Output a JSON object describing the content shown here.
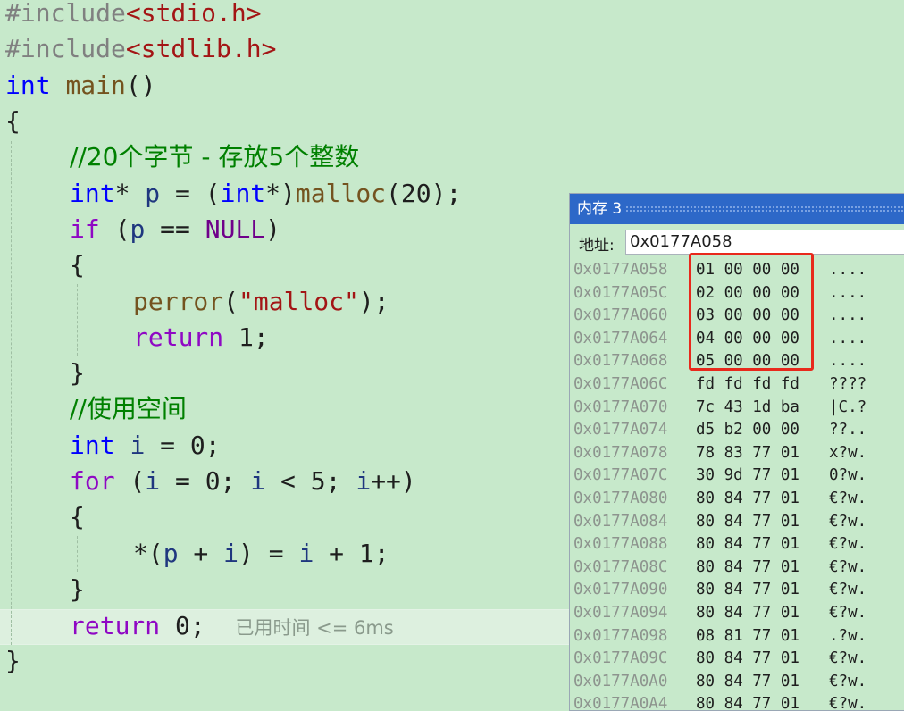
{
  "editor": {
    "include1": {
      "directive": "#include",
      "header": "<stdio.h>"
    },
    "include2": {
      "directive": "#include",
      "header": "<stdlib.h>"
    },
    "main_sig": {
      "type": "int",
      "name": "main",
      "parens": "()"
    },
    "open_brace": "{",
    "comment_alloc": "//20个字节 - 存放5个整数",
    "malloc_line": {
      "t1": "int",
      "p1": "* ",
      "var": "p",
      "p2": " = (",
      "t2": "int",
      "p3": "*)",
      "fn": "malloc",
      "p4": "(20);"
    },
    "if_line": {
      "kw": "if",
      "p1": " (",
      "var": "p",
      "p2": " == ",
      "mac": "NULL",
      "p3": ")"
    },
    "inner_open": "{",
    "perror_line": {
      "fn": "perror",
      "p1": "(",
      "str": "\"malloc\"",
      "p2": ");"
    },
    "return1_line": {
      "kw": "return",
      "rest": " 1;"
    },
    "inner_close": "}",
    "comment_use": "//使用空间",
    "int_i_line": {
      "kw": "int",
      "sp": " ",
      "var": "i",
      "rest": " = 0;"
    },
    "for_line": {
      "kw": "for",
      "p1": " (",
      "v1": "i",
      "p2": " = 0; ",
      "v2": "i",
      "p3": " < 5; ",
      "v3": "i",
      "p4": "++)"
    },
    "for_open": "{",
    "assign_line": {
      "p1": "*(",
      "v1": "p",
      "p2": " + ",
      "v2": "i",
      "p3": ") = ",
      "v3": "i",
      "p4": " + 1;"
    },
    "for_close": "}",
    "return0_line": {
      "kw": "return",
      "rest": " 0;",
      "hint": "已用时间 <= 6ms"
    },
    "close_brace": "}"
  },
  "memory_window": {
    "title": "内存 3",
    "address_label": "地址:",
    "address_value": "0x0177A058",
    "rows": [
      {
        "addr": "0x0177A058",
        "bytes": "01 00 00 00",
        "ascii": "...."
      },
      {
        "addr": "0x0177A05C",
        "bytes": "02 00 00 00",
        "ascii": "...."
      },
      {
        "addr": "0x0177A060",
        "bytes": "03 00 00 00",
        "ascii": "...."
      },
      {
        "addr": "0x0177A064",
        "bytes": "04 00 00 00",
        "ascii": "...."
      },
      {
        "addr": "0x0177A068",
        "bytes": "05 00 00 00",
        "ascii": "...."
      },
      {
        "addr": "0x0177A06C",
        "bytes": "fd fd fd fd",
        "ascii": "????"
      },
      {
        "addr": "0x0177A070",
        "bytes": "7c 43 1d ba",
        "ascii": "|C.?"
      },
      {
        "addr": "0x0177A074",
        "bytes": "d5 b2 00 00",
        "ascii": "??.."
      },
      {
        "addr": "0x0177A078",
        "bytes": "78 83 77 01",
        "ascii": "x?w."
      },
      {
        "addr": "0x0177A07C",
        "bytes": "30 9d 77 01",
        "ascii": "0?w."
      },
      {
        "addr": "0x0177A080",
        "bytes": "80 84 77 01",
        "ascii": "€?w."
      },
      {
        "addr": "0x0177A084",
        "bytes": "80 84 77 01",
        "ascii": "€?w."
      },
      {
        "addr": "0x0177A088",
        "bytes": "80 84 77 01",
        "ascii": "€?w."
      },
      {
        "addr": "0x0177A08C",
        "bytes": "80 84 77 01",
        "ascii": "€?w."
      },
      {
        "addr": "0x0177A090",
        "bytes": "80 84 77 01",
        "ascii": "€?w."
      },
      {
        "addr": "0x0177A094",
        "bytes": "80 84 77 01",
        "ascii": "€?w."
      },
      {
        "addr": "0x0177A098",
        "bytes": "08 81 77 01",
        "ascii": ".?w."
      },
      {
        "addr": "0x0177A09C",
        "bytes": "80 84 77 01",
        "ascii": "€?w."
      },
      {
        "addr": "0x0177A0A0",
        "bytes": "80 84 77 01",
        "ascii": "€?w."
      },
      {
        "addr": "0x0177A0A4",
        "bytes": "80 84 77 01",
        "ascii": "€?w."
      }
    ]
  },
  "colors": {
    "editor_background": "#c7e9cb",
    "keyword": "#0000ff",
    "control_keyword": "#8f08c4",
    "comment": "#008000",
    "string": "#a31515",
    "highlight_border": "#e8291c",
    "titlebar": "#2d68c8"
  }
}
